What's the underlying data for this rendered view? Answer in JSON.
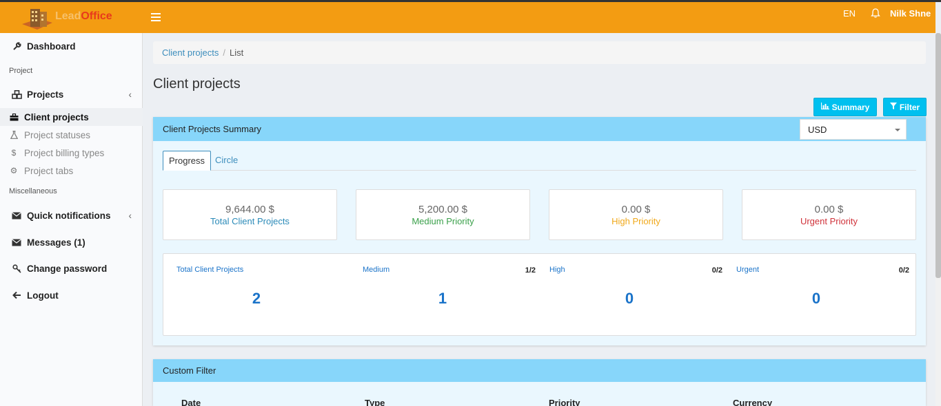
{
  "topbar": {
    "logo_part1": "Lead",
    "logo_part2": "Office",
    "language": "EN",
    "user_name": "Nilk Shne"
  },
  "sidebar": {
    "dashboard": "Dashboard",
    "section_project": "Project",
    "projects": "Projects",
    "sub_items": [
      "Client projects",
      "Project statuses",
      "Project billing types",
      "Project tabs"
    ],
    "section_misc": "Miscellaneous",
    "quick_notifications": "Quick notifications",
    "messages": "Messages (1)",
    "change_password": "Change password",
    "logout": "Logout"
  },
  "breadcrumb": {
    "link": "Client projects",
    "separator": "/",
    "current": "List"
  },
  "page": {
    "title": "Client projects",
    "summary_button": "Summary",
    "filter_button": "Filter"
  },
  "summary_panel": {
    "title": "Client Projects Summary",
    "currency": "USD",
    "tabs": [
      "Progress",
      "Circle"
    ],
    "stats": [
      {
        "amount": "9,644.00 $",
        "label": "Total Client Projects",
        "color": "#2a8ab8"
      },
      {
        "amount": "5,200.00 $",
        "label": "Medium Priority",
        "color": "#3aa04a"
      },
      {
        "amount": "0.00 $",
        "label": "High Priority",
        "color": "#f0a81a"
      },
      {
        "amount": "0.00 $",
        "label": "Urgent Priority",
        "color": "#d0323a"
      }
    ],
    "progress": [
      {
        "label": "Total Client Projects",
        "ratio": "",
        "value": "2"
      },
      {
        "label": "Medium",
        "ratio": "1/2",
        "value": "1"
      },
      {
        "label": "High",
        "ratio": "0/2",
        "value": "0"
      },
      {
        "label": "Urgent",
        "ratio": "0/2",
        "value": "0"
      }
    ]
  },
  "filter_panel": {
    "title": "Custom Filter",
    "columns": [
      "Date",
      "Type",
      "Priority",
      "Currency"
    ]
  }
}
